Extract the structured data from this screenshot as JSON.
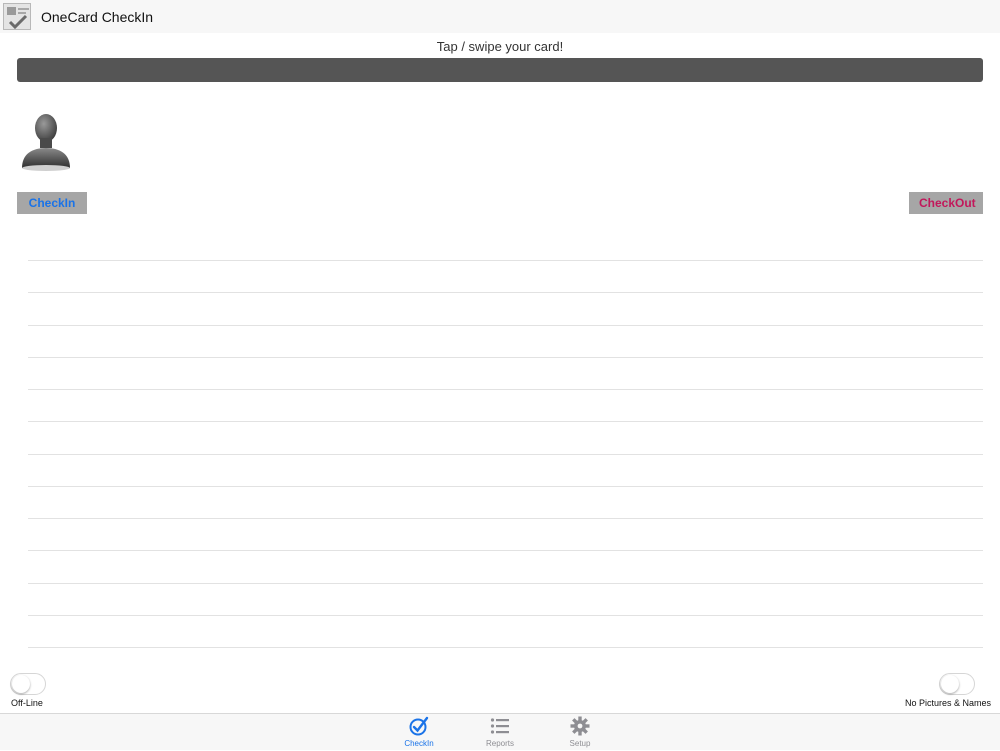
{
  "header": {
    "title": "OneCard CheckIn",
    "icon": "app-icon"
  },
  "prompt": "Tap / swipe your card!",
  "avatar": {
    "icon": "person-silhouette-icon"
  },
  "buttons": {
    "checkin_label": "CheckIn",
    "checkout_label": "CheckOut",
    "checkin_color": "#1a73e8",
    "checkout_color": "#c2185b"
  },
  "list": {
    "rows": 13
  },
  "toggles": {
    "offline": {
      "label": "Off-Line",
      "on": false
    },
    "no_pictures": {
      "label": "No Pictures & Names",
      "on": false
    }
  },
  "tabbar": {
    "tabs": [
      {
        "label": "CheckIn",
        "icon": "checkmark-circle-icon",
        "active": true
      },
      {
        "label": "Reports",
        "icon": "list-icon",
        "active": false
      },
      {
        "label": "Setup",
        "icon": "gear-icon",
        "active": false
      }
    ],
    "active_color": "#1a73e8",
    "inactive_color": "#8e8e93"
  }
}
